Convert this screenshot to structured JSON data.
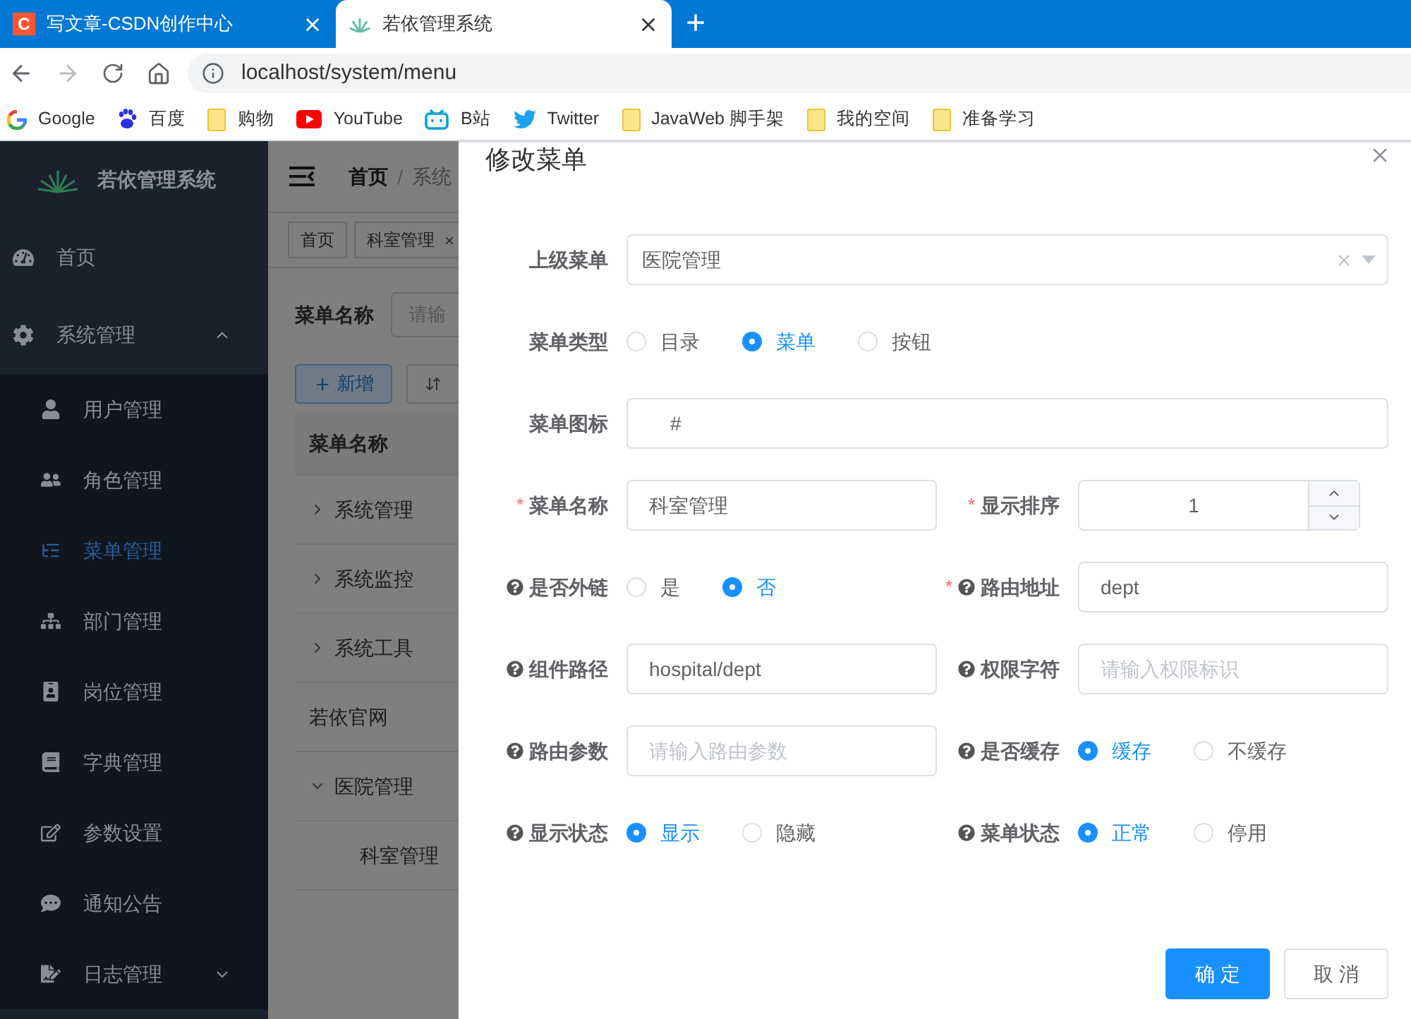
{
  "browser": {
    "tabs": [
      {
        "title": "写文章-CSDN创作中心",
        "icon_letter": "C",
        "selected": false
      },
      {
        "title": "若依管理系统",
        "selected": true
      }
    ],
    "new_tab": "+",
    "address": "localhost/system/menu",
    "bookmarks": [
      {
        "label": "Google",
        "kind": "site"
      },
      {
        "label": "百度",
        "kind": "site"
      },
      {
        "label": "购物",
        "kind": "folder"
      },
      {
        "label": "YouTube",
        "kind": "site"
      },
      {
        "label": "B站",
        "kind": "site"
      },
      {
        "label": "Twitter",
        "kind": "site"
      },
      {
        "label": "JavaWeb 脚手架",
        "kind": "folder"
      },
      {
        "label": "我的空间",
        "kind": "folder"
      },
      {
        "label": "准备学习",
        "kind": "folder"
      }
    ]
  },
  "sidebar": {
    "title": "若依管理系统",
    "items": [
      {
        "label": "首页",
        "selected": false
      },
      {
        "label": "系统管理",
        "selected": false,
        "expanded": true,
        "children": [
          {
            "label": "用户管理",
            "selected": false
          },
          {
            "label": "角色管理",
            "selected": false
          },
          {
            "label": "菜单管理",
            "selected": true
          },
          {
            "label": "部门管理",
            "selected": false
          },
          {
            "label": "岗位管理",
            "selected": false
          },
          {
            "label": "字典管理",
            "selected": false
          },
          {
            "label": "参数设置",
            "selected": false
          },
          {
            "label": "通知公告",
            "selected": false
          },
          {
            "label": "日志管理",
            "selected": false,
            "expanded": false
          }
        ]
      }
    ]
  },
  "main": {
    "breadcrumb": [
      "首页",
      "系统"
    ],
    "tags": [
      {
        "label": "首页",
        "closable": false
      },
      {
        "label": "科室管理",
        "closable": true
      }
    ],
    "search": {
      "label": "菜单名称",
      "placeholder": "请输"
    },
    "buttons": [
      {
        "label": "新增",
        "kind": "add"
      },
      {
        "kind": "sort"
      }
    ],
    "table": {
      "columns": [
        "菜单名称"
      ],
      "rows": [
        {
          "name": "系统管理",
          "expanded": false
        },
        {
          "name": "系统监控",
          "expanded": false
        },
        {
          "name": "系统工具",
          "expanded": false
        },
        {
          "name": "若依官网"
        },
        {
          "name": "医院管理",
          "expanded": true,
          "children": [
            {
              "name": "科室管理"
            }
          ]
        }
      ]
    }
  },
  "dialog": {
    "title": "修改菜单",
    "rows": [
      [
        {
          "kind": "select",
          "label": "上级菜单",
          "value": "医院管理"
        }
      ],
      [
        {
          "kind": "radio",
          "label": "菜单类型",
          "options": [
            {
              "label": "目录",
              "selected": false
            },
            {
              "label": "菜单",
              "selected": true
            },
            {
              "label": "按钮",
              "selected": false
            }
          ]
        }
      ],
      [
        {
          "kind": "input",
          "label": "菜单图标",
          "value": "#"
        }
      ],
      [
        {
          "kind": "input",
          "label": "菜单名称",
          "required_mark": "*",
          "value": "科室管理"
        },
        {
          "kind": "number",
          "label": "显示排序",
          "required_mark": "*",
          "value": "1"
        }
      ],
      [
        {
          "kind": "radio",
          "label": "是否外链",
          "help": true,
          "options": [
            {
              "label": "是",
              "selected": false
            },
            {
              "label": "否",
              "selected": true
            }
          ]
        },
        {
          "kind": "input",
          "label": "路由地址",
          "required_mark": "*",
          "help": true,
          "value": "dept"
        }
      ],
      [
        {
          "kind": "input",
          "label": "组件路径",
          "help": true,
          "value": "hospital/dept"
        },
        {
          "kind": "input",
          "label": "权限字符",
          "help": true,
          "placeholder": "请输入权限标识"
        }
      ],
      [
        {
          "kind": "input",
          "label": "路由参数",
          "help": true,
          "placeholder": "请输入路由参数"
        },
        {
          "kind": "radio",
          "label": "是否缓存",
          "help": true,
          "options": [
            {
              "label": "缓存",
              "selected": true
            },
            {
              "label": "不缓存",
              "selected": false
            }
          ]
        }
      ],
      [
        {
          "kind": "radio",
          "label": "显示状态",
          "help": true,
          "options": [
            {
              "label": "显示",
              "selected": true
            },
            {
              "label": "隐藏",
              "selected": false
            }
          ]
        },
        {
          "kind": "radio",
          "label": "菜单状态",
          "help": true,
          "options": [
            {
              "label": "正常",
              "selected": true
            },
            {
              "label": "停用",
              "selected": false
            }
          ]
        }
      ]
    ],
    "footer": [
      {
        "label": "确 定",
        "kind": "primary"
      },
      {
        "label": "取 消",
        "kind": "default"
      }
    ]
  }
}
